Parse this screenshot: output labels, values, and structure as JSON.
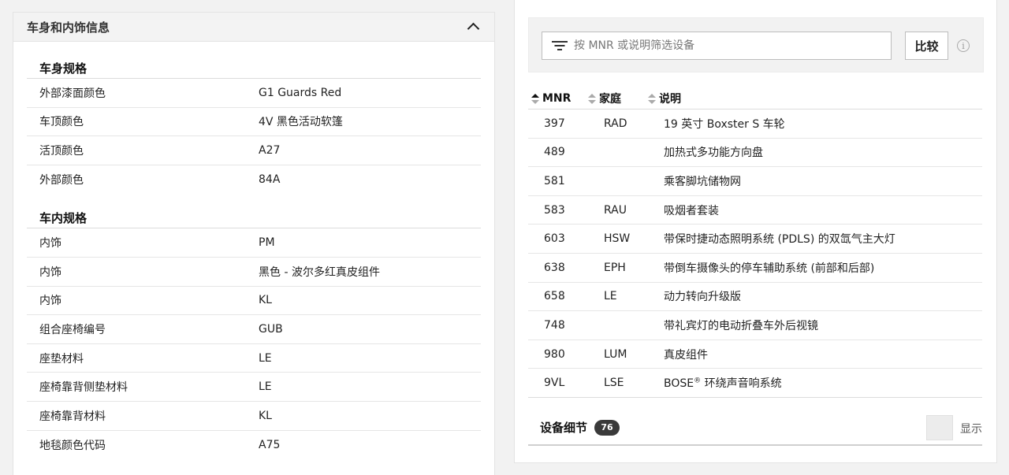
{
  "left": {
    "header_title": "车身和内饰信息",
    "sections": [
      {
        "heading": "车身规格",
        "rows": [
          {
            "label": "外部漆面颜色",
            "value": "G1 Guards Red"
          },
          {
            "label": "车顶颜色",
            "value": "4V 黑色活动软篷"
          },
          {
            "label": "活顶颜色",
            "value": "A27"
          },
          {
            "label": "外部颜色",
            "value": "84A"
          }
        ]
      },
      {
        "heading": "车内规格",
        "rows": [
          {
            "label": "内饰",
            "value": "PM"
          },
          {
            "label": "内饰",
            "value": "黑色 - 波尔多红真皮组件"
          },
          {
            "label": "内饰",
            "value": "KL"
          },
          {
            "label": "组合座椅编号",
            "value": "GUB"
          },
          {
            "label": "座垫材料",
            "value": "LE"
          },
          {
            "label": "座椅靠背侧垫材料",
            "value": "LE"
          },
          {
            "label": "座椅靠背材料",
            "value": "KL"
          },
          {
            "label": "地毯颜色代码",
            "value": "A75"
          }
        ]
      }
    ]
  },
  "right": {
    "filter_placeholder": "按 MNR 或说明筛选设备",
    "compare_label": "比较",
    "info_icon": "i",
    "columns": [
      "MNR",
      "家庭",
      "说明"
    ],
    "rows": [
      {
        "mnr": "397",
        "family": "RAD",
        "desc": "19 英寸 Boxster S 车轮"
      },
      {
        "mnr": "489",
        "family": "",
        "desc": "加热式多功能方向盘"
      },
      {
        "mnr": "581",
        "family": "",
        "desc": "乘客脚坑储物网"
      },
      {
        "mnr": "583",
        "family": "RAU",
        "desc": "吸烟者套装"
      },
      {
        "mnr": "603",
        "family": "HSW",
        "desc": "带保时捷动态照明系统 (PDLS) 的双氙气主大灯"
      },
      {
        "mnr": "638",
        "family": "EPH",
        "desc": "带倒车摄像头的停车辅助系统 (前部和后部)"
      },
      {
        "mnr": "658",
        "family": "LE",
        "desc": "动力转向升级版"
      },
      {
        "mnr": "748",
        "family": "",
        "desc": "带礼宾灯的电动折叠车外后视镜"
      },
      {
        "mnr": "980",
        "family": "LUM",
        "desc": "真皮组件"
      },
      {
        "mnr": "9VL",
        "family": "LSE",
        "desc_main": "BOSE",
        "desc_sup": "®",
        "desc_rest": " 环绕声音响系统"
      }
    ],
    "detail_label": "设备细节",
    "detail_count": "76",
    "show_label": "显示"
  }
}
